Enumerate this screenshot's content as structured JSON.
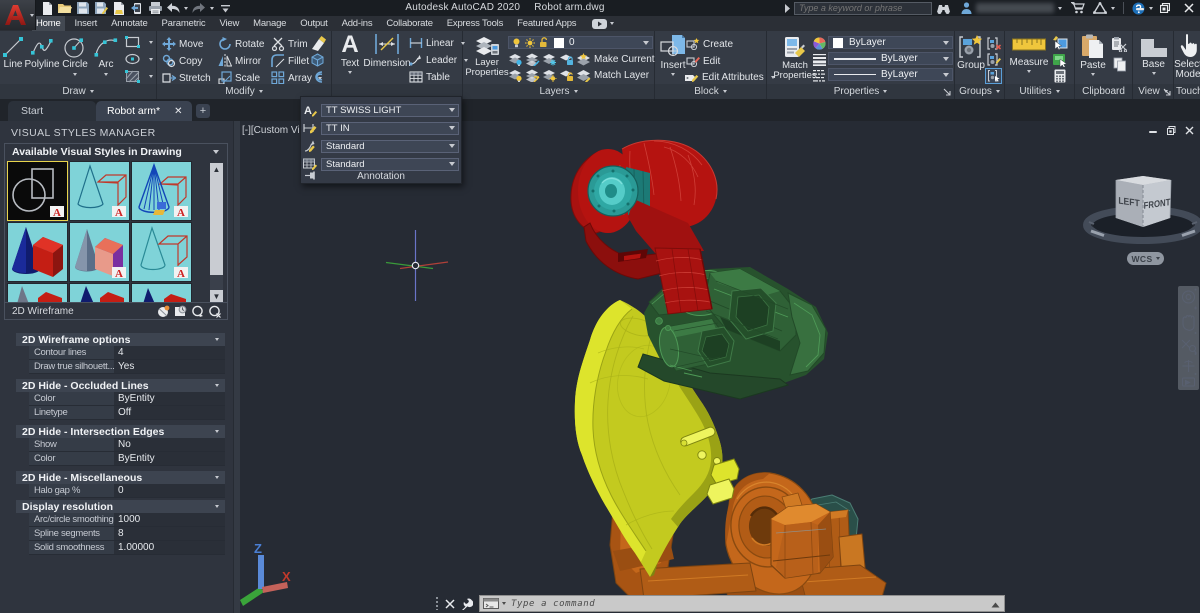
{
  "title_bar": {
    "app_title": "Autodesk AutoCAD 2020",
    "doc_title": "Robot arm.dwg",
    "search_placeholder": "Type a keyword or phrase"
  },
  "menu": {
    "items": [
      "Home",
      "Insert",
      "Annotate",
      "Parametric",
      "View",
      "Manage",
      "Output",
      "Add-ins",
      "Collaborate",
      "Express Tools",
      "Featured Apps"
    ],
    "active": "Home"
  },
  "ribbon": {
    "draw": {
      "label": "Draw",
      "line": "Line",
      "polyline": "Polyline",
      "circle": "Circle",
      "arc": "Arc"
    },
    "modify": {
      "label": "Modify",
      "move": "Move",
      "rotate": "Rotate",
      "trim": "Trim",
      "copy": "Copy",
      "mirror": "Mirror",
      "fillet": "Fillet",
      "stretch": "Stretch",
      "scale": "Scale",
      "array": "Array"
    },
    "annotation": {
      "text": "Text",
      "dimension": "Dimension",
      "linear": "Linear",
      "leader": "Leader",
      "table": "Table"
    },
    "layers": {
      "label": "Layers",
      "layer_properties": "Layer Properties",
      "layer_value": "0",
      "make_current": "Make Current",
      "match_layer": "Match Layer"
    },
    "block": {
      "label": "Block",
      "insert": "Insert",
      "create": "Create",
      "edit": "Edit",
      "edit_attributes": "Edit Attributes"
    },
    "properties": {
      "label": "Properties",
      "match_properties": "Match Properties",
      "color_value": "ByLayer",
      "lineweight_value": "ByLayer",
      "linetype_value": "ByLayer"
    },
    "groups": {
      "label": "Groups",
      "group": "Group"
    },
    "utilities": {
      "label": "Utilities",
      "measure": "Measure"
    },
    "clipboard": {
      "label": "Clipboard",
      "paste": "Paste"
    },
    "view": {
      "label": "View",
      "base": "Base"
    },
    "touch": {
      "label": "Touch",
      "select_mode": "Select Mode"
    }
  },
  "annotation_flyout": {
    "text_style": "TT SWISS LIGHT",
    "dim_style": "TT IN",
    "mleader_style": "Standard",
    "table_style": "Standard",
    "label": "Annotation"
  },
  "file_tabs": {
    "start": "Start",
    "doc": "Robot arm*"
  },
  "palette": {
    "title": "VISUAL STYLES MANAGER",
    "styles_header": "Available Visual Styles in Drawing",
    "selected_style": "2D Wireframe",
    "sections": [
      {
        "title": "2D Wireframe options",
        "rows": [
          [
            "Contour lines",
            "4"
          ],
          [
            "Draw true silhouett...",
            "Yes"
          ]
        ]
      },
      {
        "title": "2D Hide - Occluded Lines",
        "rows": [
          [
            "Color",
            "ByEntity"
          ],
          [
            "Linetype",
            "Off"
          ]
        ]
      },
      {
        "title": "2D Hide - Intersection Edges",
        "rows": [
          [
            "Show",
            "No"
          ],
          [
            "Color",
            "ByEntity"
          ]
        ]
      },
      {
        "title": "2D Hide - Miscellaneous",
        "rows": [
          [
            "Halo gap %",
            "0"
          ]
        ]
      },
      {
        "title": "Display resolution",
        "rows": [
          [
            "Arc/circle smoothing",
            "1000"
          ],
          [
            "Spline segments",
            "8"
          ],
          [
            "Solid smoothness",
            "1.00000"
          ]
        ]
      }
    ]
  },
  "canvas": {
    "viewport_label": "[-][Custom Vie",
    "viewcube_left": "LEFT",
    "viewcube_front": "FRONT",
    "wcs": "WCS",
    "command_placeholder": "Type a command"
  },
  "colors": {
    "canvas_bg": "#262b34",
    "ribbon_bg": "#353b45",
    "accent_blue": "#6fa8d8",
    "robot_red": "#b51310",
    "robot_teal": "#3ab8b4",
    "robot_green": "#2f6136",
    "robot_yellow": "#c3ca1f",
    "robot_orange": "#c4671b",
    "thumb_cyan": "#7fd3d8"
  }
}
